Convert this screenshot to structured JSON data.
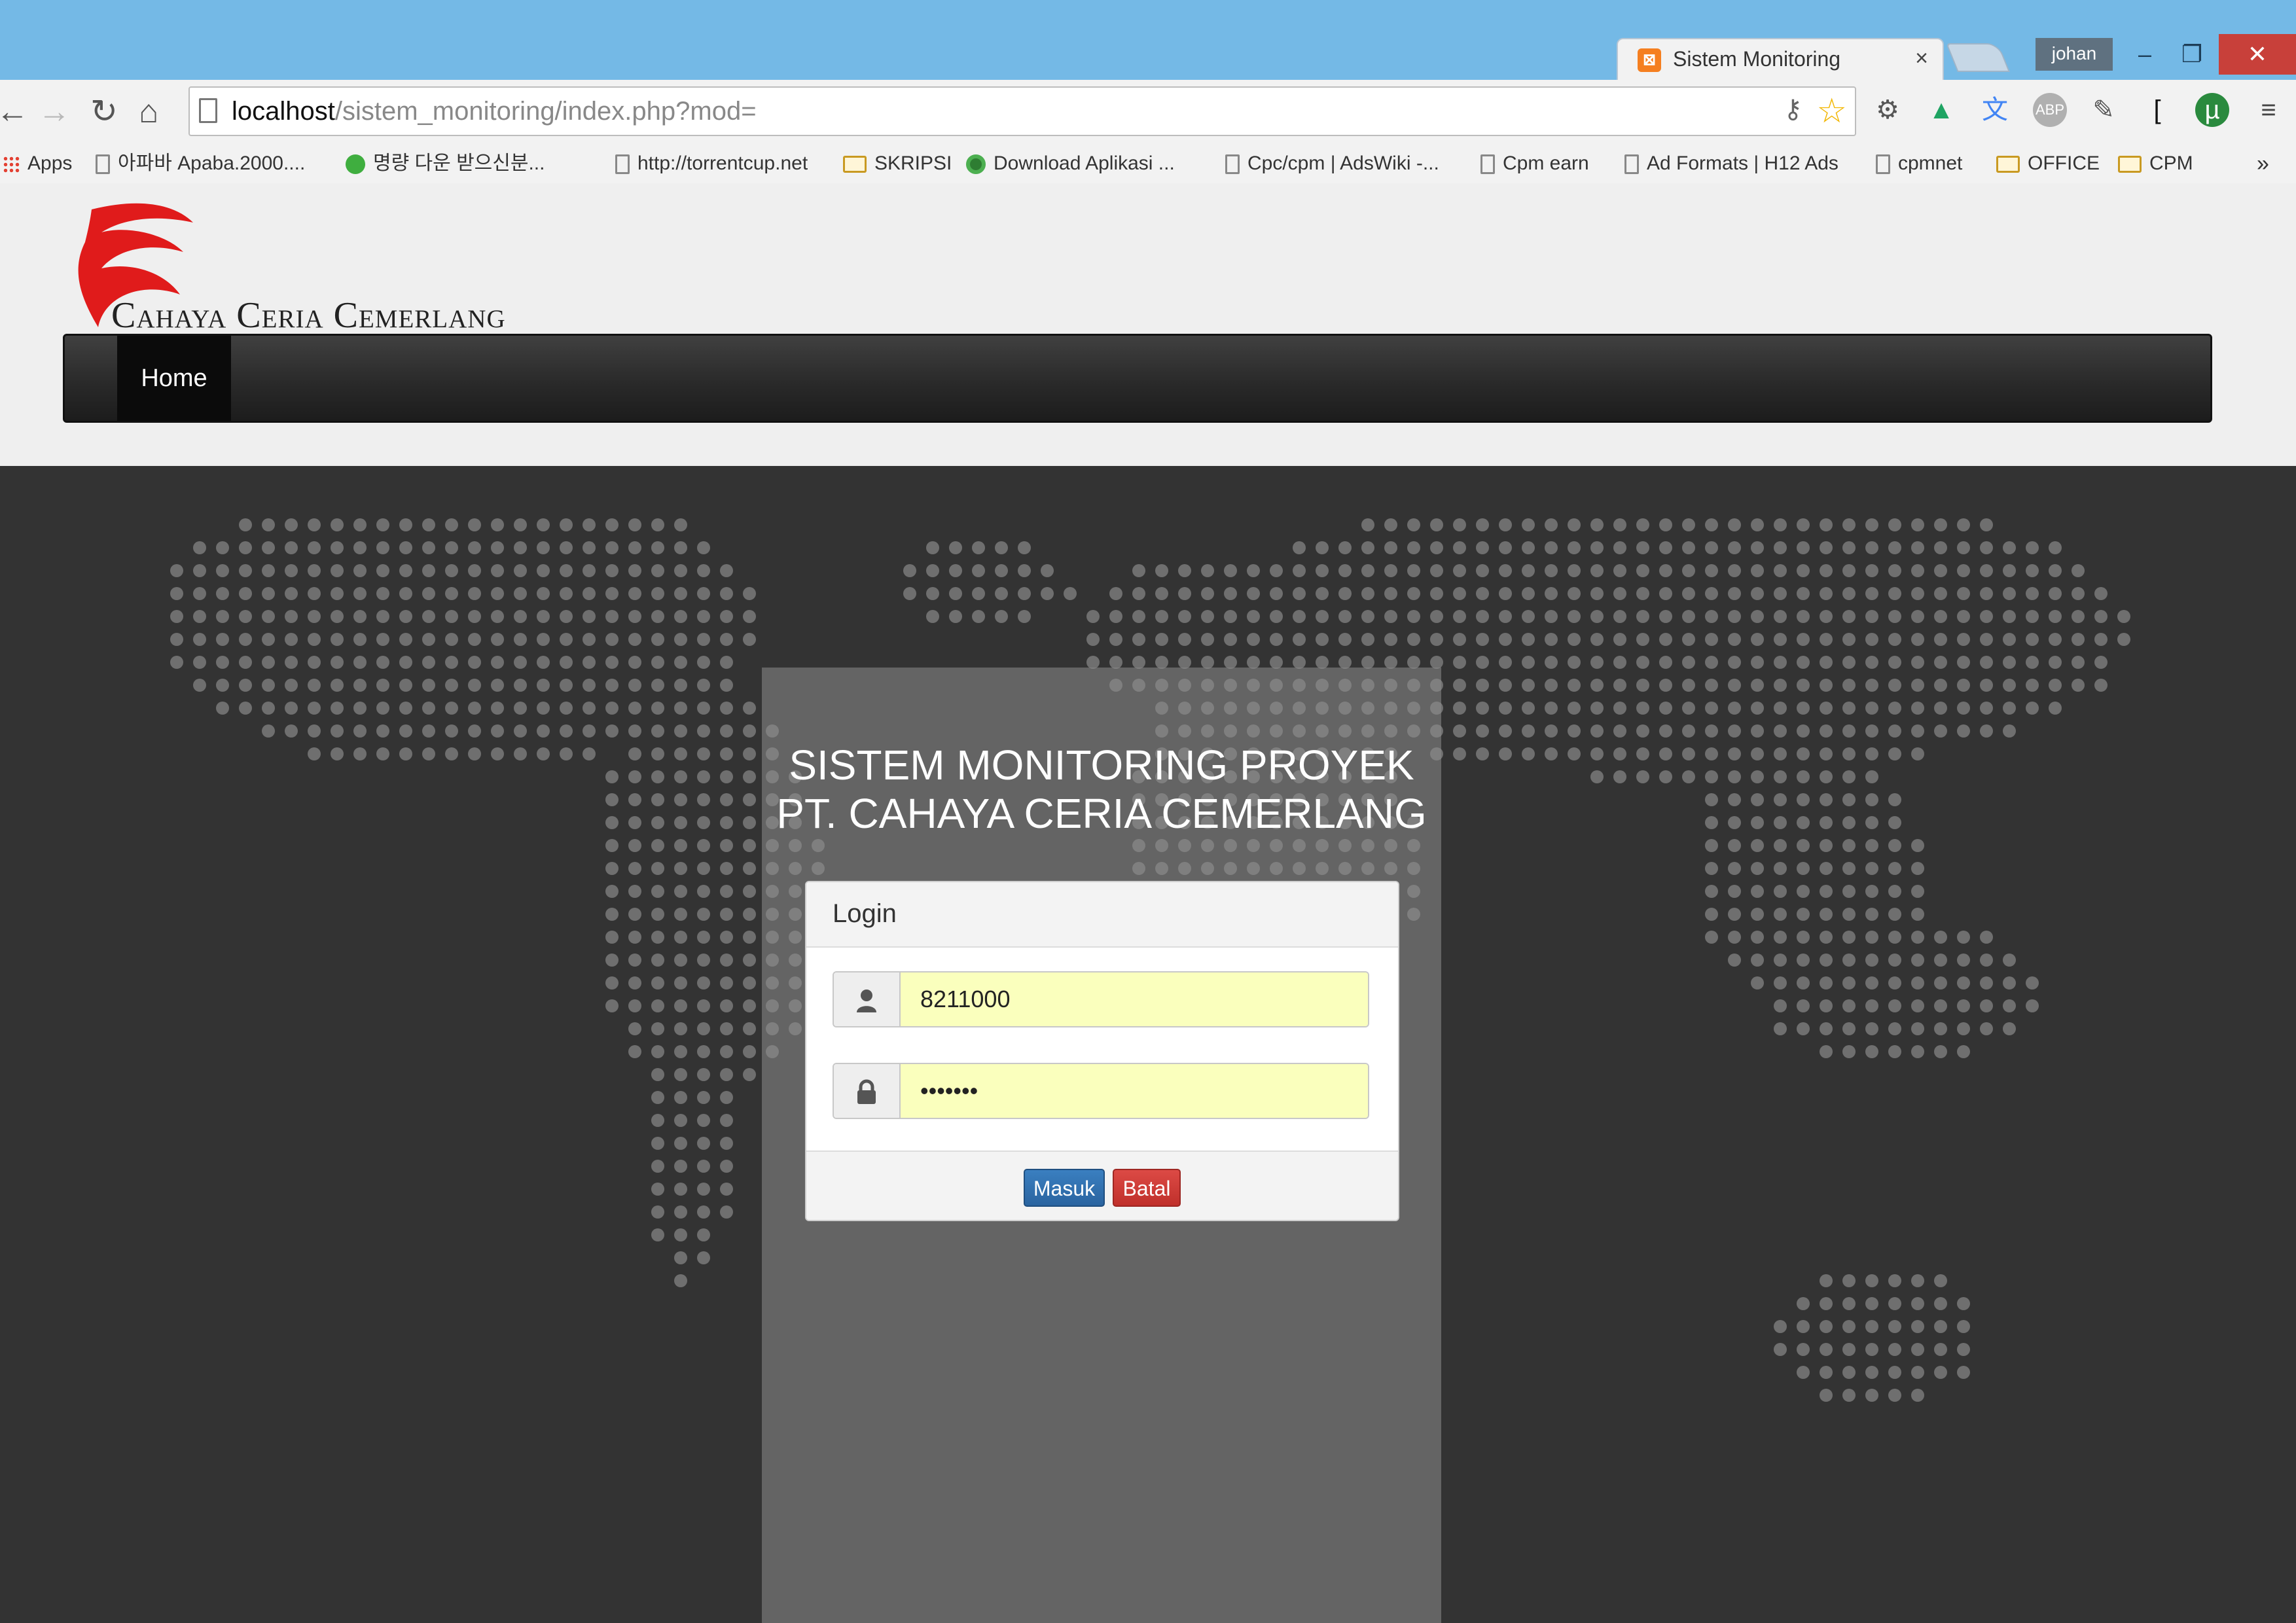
{
  "browser": {
    "tab": {
      "title": "Sistem Monitoring",
      "close": "×"
    },
    "user": "johan",
    "window": {
      "minimize": "–",
      "restore": "❐",
      "close": "✕"
    },
    "url": {
      "host": "localhost",
      "path": "/sistem_monitoring/index.php?mod="
    },
    "bookmarks": [
      {
        "label": "Apps",
        "icon": "apps-grid-icon"
      },
      {
        "label": "아파바 Apaba.2000....",
        "icon": "page-icon"
      },
      {
        "label": "명량 다운 받으신분...",
        "icon": "green-circle-icon"
      },
      {
        "label": "http://torrentcup.net",
        "icon": "page-icon"
      },
      {
        "label": "SKRIPSI",
        "icon": "folder-icon"
      },
      {
        "label": "Download Aplikasi ...",
        "icon": "green-dot-icon"
      },
      {
        "label": "Cpc/cpm | AdsWiki -...",
        "icon": "page-icon"
      },
      {
        "label": "Cpm earn",
        "icon": "page-icon"
      },
      {
        "label": "Ad Formats | H12 Ads",
        "icon": "page-icon"
      },
      {
        "label": "cpmnet",
        "icon": "page-icon"
      },
      {
        "label": "OFFICE",
        "icon": "folder-icon"
      },
      {
        "label": "CPM",
        "icon": "folder-icon"
      }
    ],
    "bookmarks_more": "»",
    "extensions": [
      "translate-icon",
      "drive-icon",
      "google-translate-icon",
      "adblock-icon",
      "pen-icon",
      "bracket-icon",
      "utorrent-icon",
      "menu-icon"
    ]
  },
  "site": {
    "logo_text": "Cahaya Ceria Cemerlang",
    "nav": {
      "home": "Home"
    }
  },
  "app": {
    "title_line1": "SISTEM MONITORING PROYEK",
    "title_line2": "PT. CAHAYA CERIA CEMERLANG"
  },
  "login": {
    "heading": "Login",
    "username_value": "8211000",
    "password_value": "•••••••",
    "submit_label": "Masuk",
    "cancel_label": "Batal"
  },
  "colors": {
    "titlebar": "#74b9e6",
    "navbar": "#222222",
    "stage": "#333333",
    "autofill": "#faffbd",
    "primary_button": "#2a64a0",
    "danger_button": "#c0302b",
    "logo_red": "#e01b1b"
  }
}
